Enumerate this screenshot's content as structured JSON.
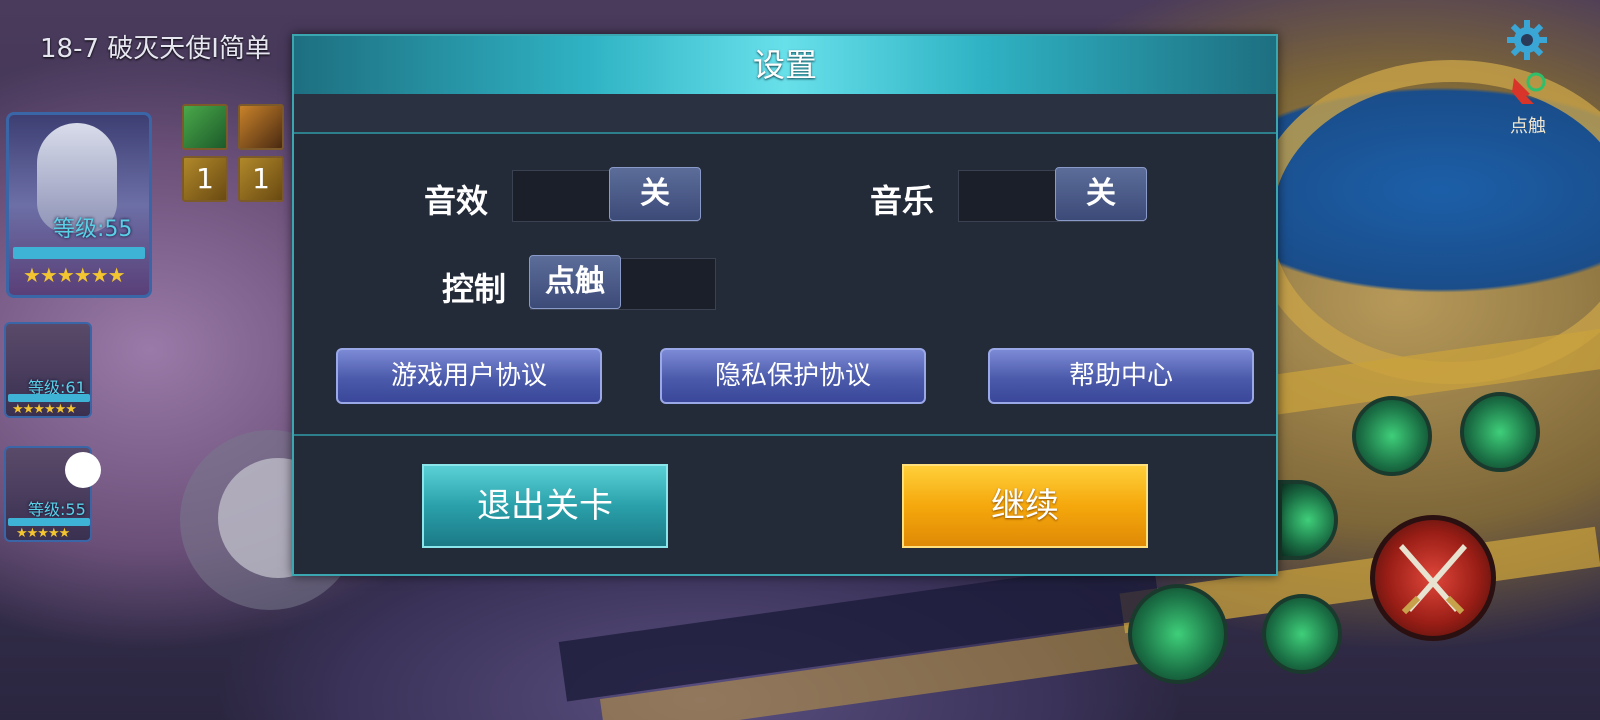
{
  "hud": {
    "level_title": "18-7 破灭天使I简单",
    "main_hero": {
      "level": "等级:55",
      "stars": "★★★★★★"
    },
    "hero_2": {
      "level": "等级:61",
      "stars": "★★★★★★"
    },
    "hero_3": {
      "level": "等级:55",
      "stars": "★★★★★"
    },
    "item_count_1": "1",
    "item_count_2": "1",
    "touch_hint": "点触"
  },
  "dialog": {
    "title": "设置",
    "sound_effect": {
      "label": "音效",
      "state": "关"
    },
    "music": {
      "label": "音乐",
      "state": "关"
    },
    "control": {
      "label": "控制",
      "mode": "点触"
    },
    "links": {
      "user_agreement": "游戏用户协议",
      "privacy_agreement": "隐私保护协议",
      "help_center": "帮助中心"
    },
    "exit_button": "退出关卡",
    "continue_button": "继续"
  },
  "colors": {
    "dialog_bg": "#232a38",
    "header_accent": "#2fb3c4",
    "blue_button": "#4b5aaa",
    "exit_button": "#2aa0aa",
    "continue_button": "#f5a80c"
  }
}
